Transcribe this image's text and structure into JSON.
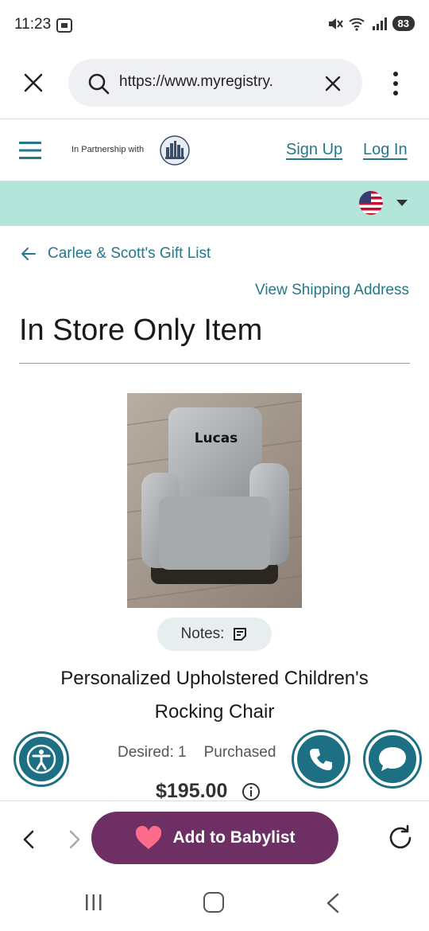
{
  "status_bar": {
    "time": "11:23",
    "battery": "83",
    "icons": [
      "screenshot-icon",
      "mute-icon",
      "wifi-icon",
      "signal-icon",
      "battery-icon"
    ]
  },
  "browser": {
    "url": "https://www.myregistry.",
    "icons": [
      "close-icon",
      "search-icon",
      "clear-icon",
      "more-vert-icon"
    ]
  },
  "header": {
    "partner_text": "In Partnership with",
    "sign_up": "Sign Up",
    "log_in": "Log In"
  },
  "colors": {
    "teal_link": "#24788a",
    "band": "#b4e5da",
    "fab": "#1d6f83",
    "babylist": "#6e2f64"
  },
  "page": {
    "back_link": "Carlee & Scott's Gift List",
    "shipping_link": "View Shipping Address",
    "title": "In Store Only Item",
    "image_text": "Lucas",
    "notes_label": "Notes:",
    "product_name": "Personalized Upholstered Children's Rocking Chair",
    "desired": "Desired: 1",
    "purchased": "Purchased",
    "price": "$195.00"
  },
  "toolbar": {
    "add_button": "Add to Babylist"
  }
}
